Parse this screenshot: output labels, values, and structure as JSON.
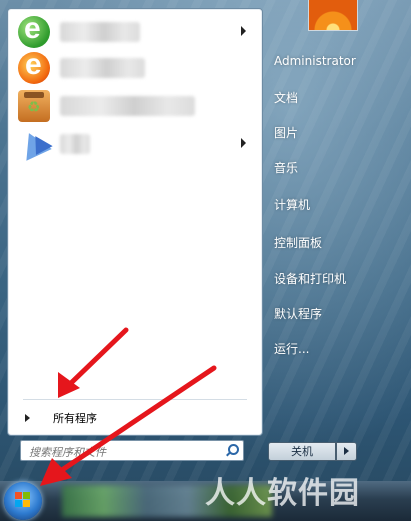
{
  "left_panel": {
    "all_programs_label": "所有程序",
    "search_placeholder": "搜索程序和文件"
  },
  "right_panel": {
    "items": [
      "Administrator",
      "文档",
      "图片",
      "音乐",
      "计算机",
      "控制面板",
      "设备和打印机",
      "默认程序",
      "运行..."
    ],
    "shutdown_label": "关机"
  },
  "watermark": "人人软件园",
  "colors": {
    "annotation_arrow": "#e5161c",
    "panel_bg": "#ffffff",
    "right_text": "#ffffff"
  }
}
